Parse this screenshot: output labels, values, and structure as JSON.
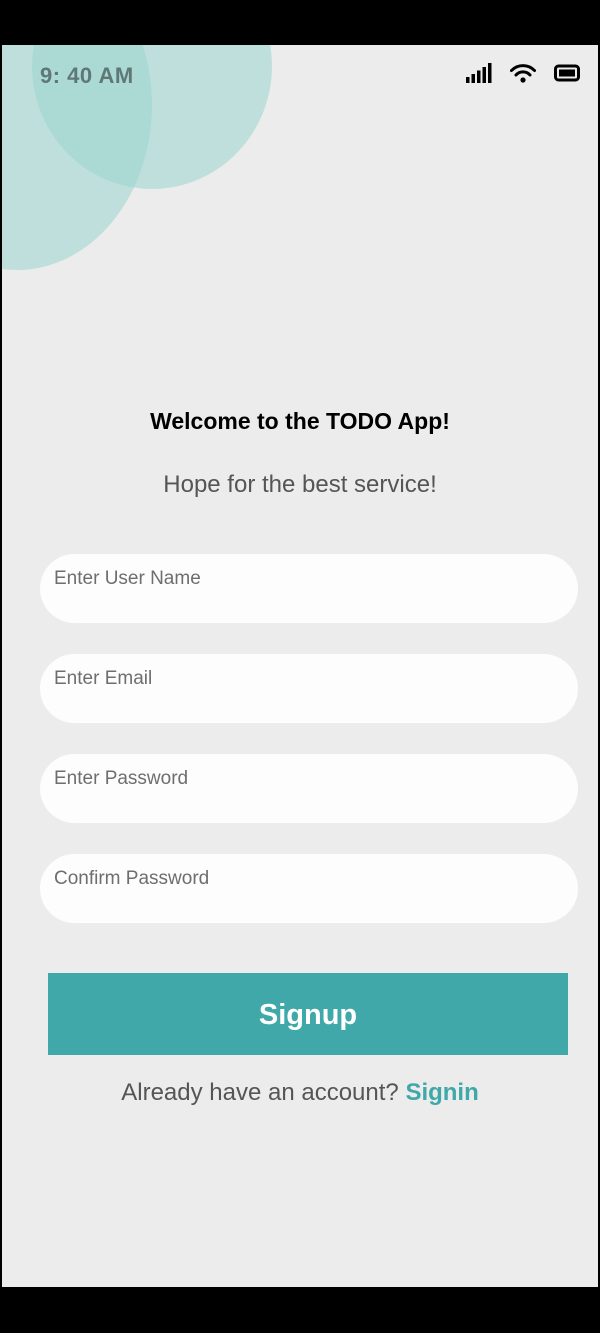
{
  "status_bar": {
    "time": "9: 40 AM",
    "icons": [
      "signal-icon",
      "wifi-icon",
      "battery-icon"
    ]
  },
  "header": {
    "title": "Welcome to the TODO App!",
    "subtitle": "Hope for the best service!"
  },
  "form": {
    "username_placeholder": "Enter User Name",
    "email_placeholder": "Enter Email",
    "password_placeholder": "Enter Password",
    "confirm_password_placeholder": "Confirm Password",
    "signup_label": "Signup"
  },
  "footer": {
    "prompt": "Already have an account?",
    "signin_label": "Signin"
  },
  "colors": {
    "accent": "#40a8a8",
    "background": "#ececec",
    "blob": "#9bd6d0"
  }
}
